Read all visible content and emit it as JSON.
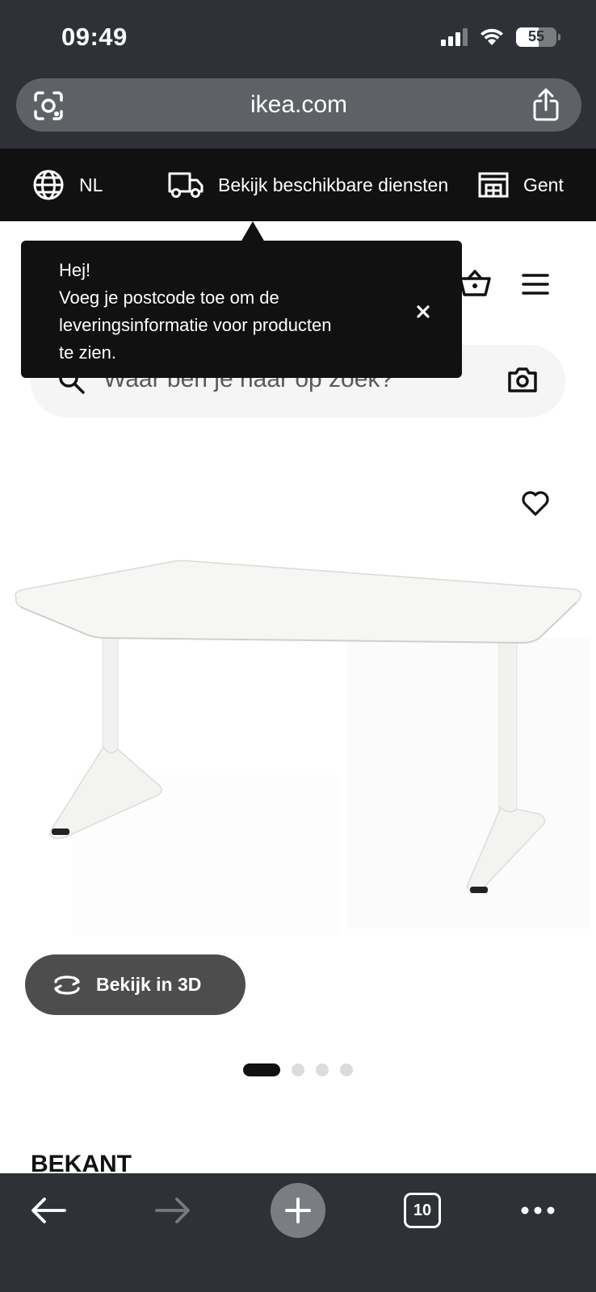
{
  "status_bar": {
    "time": "09:49",
    "battery_level": "55",
    "icons": [
      "signal-icon",
      "wifi-icon",
      "battery-icon"
    ]
  },
  "browser": {
    "url": "ikea.com",
    "tab_count": "10",
    "icons": [
      "lens-icon",
      "share-icon",
      "back-arrow-icon",
      "forward-arrow-icon",
      "plus-icon",
      "tabs-icon",
      "more-dots-icon"
    ]
  },
  "services": {
    "language": "NL",
    "delivery": "Bekijk beschikbare diensten",
    "store": "Gent"
  },
  "tooltip": {
    "lines": [
      "Hej!",
      "Voeg je postcode toe om de",
      "leveringsinformatie voor producten",
      "te zien."
    ]
  },
  "search": {
    "placeholder": "Waar ben je naar op zoek?"
  },
  "product": {
    "view_3d_label": "Bekijk in 3D",
    "name": "BEKANT",
    "image_count": 4,
    "active_image": 1
  },
  "colors": {
    "chrome": "#2e3236",
    "service_bar": "#111111",
    "button_dark": "#4d4d4d"
  }
}
